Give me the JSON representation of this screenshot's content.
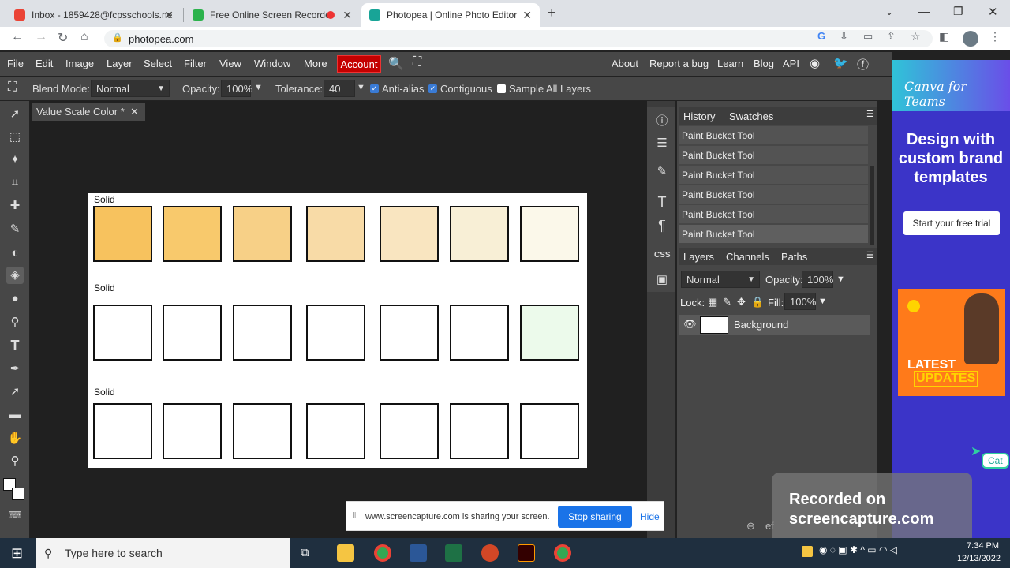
{
  "browser": {
    "tabs": [
      {
        "title": "Inbox - 1859428@fcpsschools.ne",
        "active": false
      },
      {
        "title": "Free Online Screen Recorder",
        "active": false
      },
      {
        "title": "Photopea | Online Photo Editor",
        "active": true
      }
    ],
    "url": "photopea.com"
  },
  "menu": {
    "items": [
      "File",
      "Edit",
      "Image",
      "Layer",
      "Select",
      "Filter",
      "View",
      "Window",
      "More"
    ],
    "account": "Account",
    "right_links": [
      "About",
      "Report a bug",
      "Learn",
      "Blog",
      "API"
    ]
  },
  "options": {
    "blend_label": "Blend Mode:",
    "blend_value": "Normal",
    "opacity_label": "Opacity:",
    "opacity_value": "100%",
    "tolerance_label": "Tolerance:",
    "tolerance_value": "40",
    "antialias": "Anti-alias",
    "contiguous": "Contiguous",
    "sample_all": "Sample All Layers"
  },
  "document": {
    "tab_title": "Value Scale Color *",
    "rows": [
      {
        "label": "Solid",
        "fills": [
          "#f7c25e",
          "#f8c96c",
          "#f7d087",
          "#f8dba7",
          "#f9e5c0",
          "#f8efd6",
          "#fbf8ea"
        ]
      },
      {
        "label": "Solid",
        "fills": [
          "#ffffff",
          "#ffffff",
          "#ffffff",
          "#ffffff",
          "#ffffff",
          "#ffffff",
          "#ecfaeb"
        ]
      },
      {
        "label": "Solid",
        "fills": [
          "#ffffff",
          "#ffffff",
          "#ffffff",
          "#ffffff",
          "#ffffff",
          "#ffffff",
          "#ffffff"
        ]
      }
    ]
  },
  "history": {
    "tabs": [
      "History",
      "Swatches"
    ],
    "items": [
      "Paint Bucket Tool",
      "Paint Bucket Tool",
      "Paint Bucket Tool",
      "Paint Bucket Tool",
      "Paint Bucket Tool",
      "Paint Bucket Tool"
    ]
  },
  "layers": {
    "tabs": [
      "Layers",
      "Channels",
      "Paths"
    ],
    "blend": "Normal",
    "opacity_label": "Opacity:",
    "opacity": "100%",
    "lock_label": "Lock:",
    "fill_label": "Fill:",
    "fill": "100%",
    "layer_name": "Background"
  },
  "ad": {
    "brand": "Canva for Teams",
    "headline": "Design with custom brand templates",
    "cta": "Start your free trial",
    "badge_top": "LATEST",
    "badge_bottom": "UPDATES",
    "cat": "Cat"
  },
  "share_bar": {
    "message": "www.screencapture.com is sharing your screen.",
    "stop": "Stop sharing",
    "hide": "Hide"
  },
  "watermark": {
    "line1": "Recorded on",
    "line2": "screencapture.com"
  },
  "taskbar": {
    "search_placeholder": "Type here to search",
    "time": "7:34 PM",
    "date": "12/13/2022"
  }
}
